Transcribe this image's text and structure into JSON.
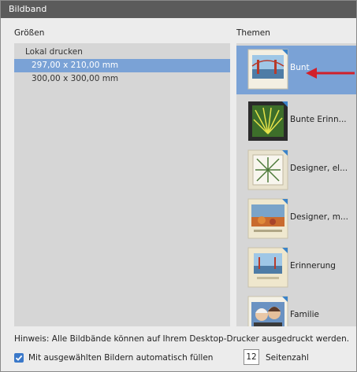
{
  "window": {
    "title": "Bildband"
  },
  "sizes": {
    "heading": "Größen",
    "group_label": "Lokal drucken",
    "options": [
      "297,00 x 210,00 mm",
      "300,00 x 300,00 mm"
    ],
    "selected_index": 0
  },
  "themes": {
    "heading": "Themen",
    "items": [
      {
        "label": "Bunt"
      },
      {
        "label": "Bunte Erinn..."
      },
      {
        "label": "Designer, el..."
      },
      {
        "label": "Designer, m..."
      },
      {
        "label": "Erinnerung"
      },
      {
        "label": "Familie"
      }
    ],
    "selected_index": 0
  },
  "footer": {
    "hint": "Hinweis: Alle Bildbände können auf Ihrem Desktop-Drucker ausgedruckt werden.",
    "autofill_label": "Mit ausgewählten Bildern automatisch füllen",
    "autofill_checked": true,
    "page_count": "12",
    "page_count_label": "Seitenzahl"
  },
  "colors": {
    "selection": "#7aa2d6",
    "annotation_arrow": "#d1202a",
    "titlebar": "#5b5b5b"
  },
  "icons": [
    "checkmark-icon",
    "red-arrow-annotation"
  ]
}
